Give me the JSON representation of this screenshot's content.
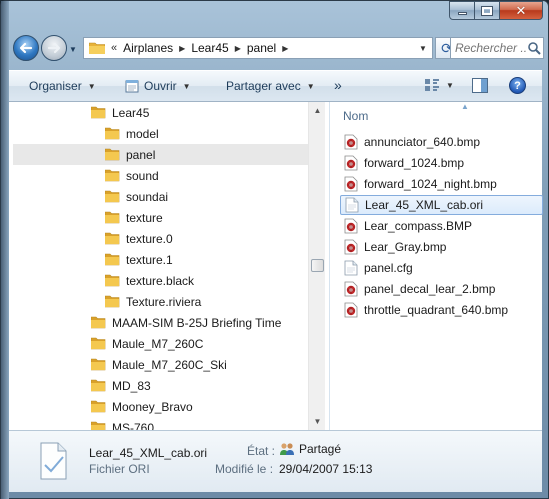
{
  "window": {
    "controls": {
      "minimize_icon": "minimize-icon",
      "maximize_icon": "maximize-icon",
      "close_glyph": "✕"
    }
  },
  "address": {
    "crumbs": [
      "Airplanes",
      "Lear45",
      "panel"
    ],
    "search_placeholder": "Rechercher ..."
  },
  "toolbar": {
    "organiser": "Organiser",
    "ouvrir": "Ouvrir",
    "partager": "Partager avec",
    "more": "»",
    "help": "?"
  },
  "nav_tree": {
    "items": [
      {
        "label": "Lear45",
        "level": 0
      },
      {
        "label": "model",
        "level": 1
      },
      {
        "label": "panel",
        "level": 1,
        "selected": true
      },
      {
        "label": "sound",
        "level": 1
      },
      {
        "label": "soundai",
        "level": 1
      },
      {
        "label": "texture",
        "level": 1
      },
      {
        "label": "texture.0",
        "level": 1
      },
      {
        "label": "texture.1",
        "level": 1
      },
      {
        "label": "texture.black",
        "level": 1
      },
      {
        "label": "Texture.riviera",
        "level": 1
      },
      {
        "label": "MAAM-SIM B-25J Briefing Time",
        "level": 0
      },
      {
        "label": "Maule_M7_260C",
        "level": 0
      },
      {
        "label": "Maule_M7_260C_Ski",
        "level": 0
      },
      {
        "label": "MD_83",
        "level": 0
      },
      {
        "label": "Mooney_Bravo",
        "level": 0
      },
      {
        "label": "MS-760",
        "level": 0
      }
    ]
  },
  "file_list": {
    "column_name": "Nom",
    "files": [
      {
        "label": "annunciator_640.bmp",
        "icon": "bmp"
      },
      {
        "label": "forward_1024.bmp",
        "icon": "bmp"
      },
      {
        "label": "forward_1024_night.bmp",
        "icon": "bmp"
      },
      {
        "label": "Lear_45_XML_cab.ori",
        "icon": "doc",
        "selected": true
      },
      {
        "label": "Lear_compass.BMP",
        "icon": "bmp"
      },
      {
        "label": "Lear_Gray.bmp",
        "icon": "bmp"
      },
      {
        "label": "panel.cfg",
        "icon": "doc"
      },
      {
        "label": "panel_decal_lear_2.bmp",
        "icon": "bmp"
      },
      {
        "label": "throttle_quadrant_640.bmp",
        "icon": "bmp"
      }
    ]
  },
  "details": {
    "name": "Lear_45_XML_cab.ori",
    "type": "Fichier ORI",
    "state_label": "État :",
    "state_value": "Partagé",
    "modified_label": "Modifié le :",
    "modified_value": "29/04/2007 15:13"
  },
  "colors": {
    "folder": "#e8b33a",
    "selection": "#dcebfc",
    "bmp_icon": "#c0282a"
  }
}
